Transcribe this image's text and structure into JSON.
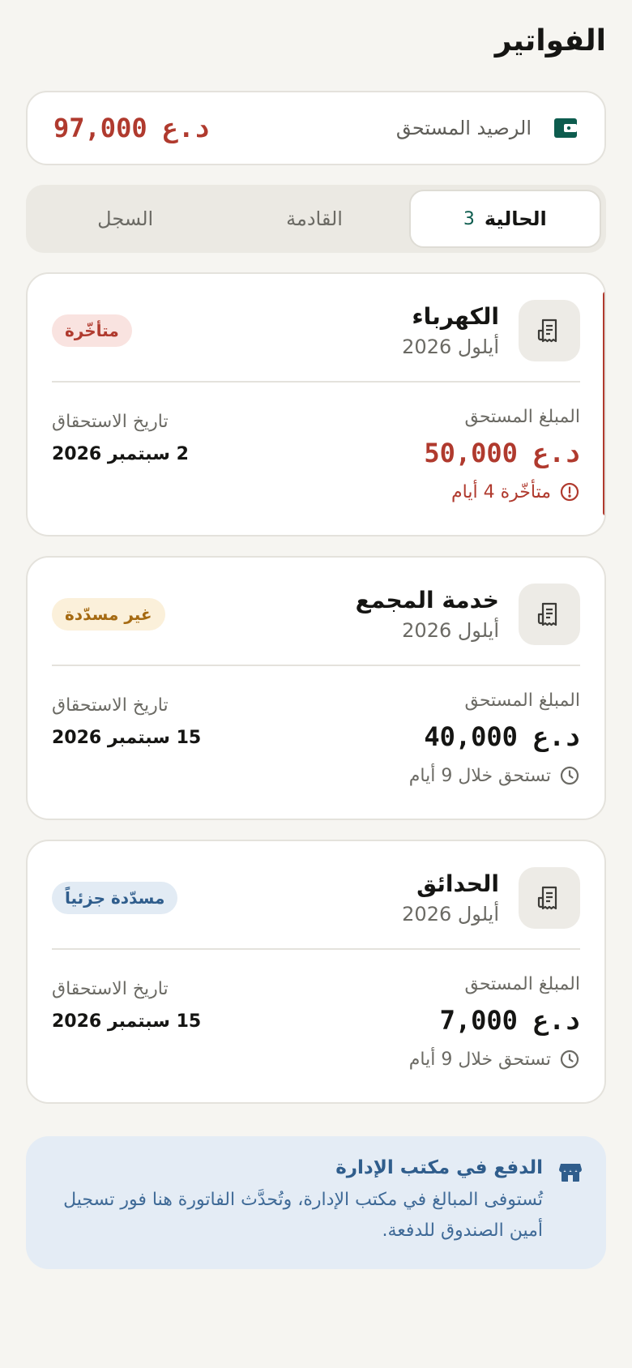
{
  "page": {
    "title": "الفواتير"
  },
  "balance": {
    "label": "الرصيد المستحق",
    "amount": "د.ع 97,000",
    "icon": "wallet-icon"
  },
  "tabs": [
    {
      "label": "الحالية",
      "count": "3",
      "active": true
    },
    {
      "label": "القادمة",
      "count": "",
      "active": false
    },
    {
      "label": "السجل",
      "count": "",
      "active": false
    }
  ],
  "bills": [
    {
      "name": "الكهرباء",
      "period": "أيلول 2026",
      "status": "متأخّرة",
      "amount_label": "المبلغ المستحق",
      "amount": "د.ع 50,000",
      "due_label": "تاريخ الاستحقاق",
      "due_date": "2 سبتمبر 2026",
      "note": "متأخّرة 4 أيام",
      "note_icon": "alert-circle-icon"
    },
    {
      "name": "خدمة المجمع",
      "period": "أيلول 2026",
      "status": "غير مسدّدة",
      "amount_label": "المبلغ المستحق",
      "amount": "د.ع 40,000",
      "due_label": "تاريخ الاستحقاق",
      "due_date": "15 سبتمبر 2026",
      "note": "تستحق خلال 9 أيام",
      "note_icon": "clock-icon"
    },
    {
      "name": "الحدائق",
      "period": "أيلول 2026",
      "status": "مسدّدة جزئياً",
      "amount_label": "المبلغ المستحق",
      "amount": "د.ع 7,000",
      "due_label": "تاريخ الاستحقاق",
      "due_date": "15 سبتمبر 2026",
      "note": "تستحق خلال 9 أيام",
      "note_icon": "clock-icon"
    }
  ],
  "info": {
    "title": "الدفع في مكتب الإدارة",
    "body": "تُستوفى المبالغ في مكتب الإدارة، وتُحدَّث الفاتورة هنا فور تسجيل أمين الصندوق للدفعة.",
    "icon": "storefront-icon"
  },
  "colors": {
    "accent_green": "#0d5c4e",
    "overdue_red": "#b03a2e",
    "unpaid_amber": "#a56a12",
    "partial_blue": "#2f5d8c"
  }
}
